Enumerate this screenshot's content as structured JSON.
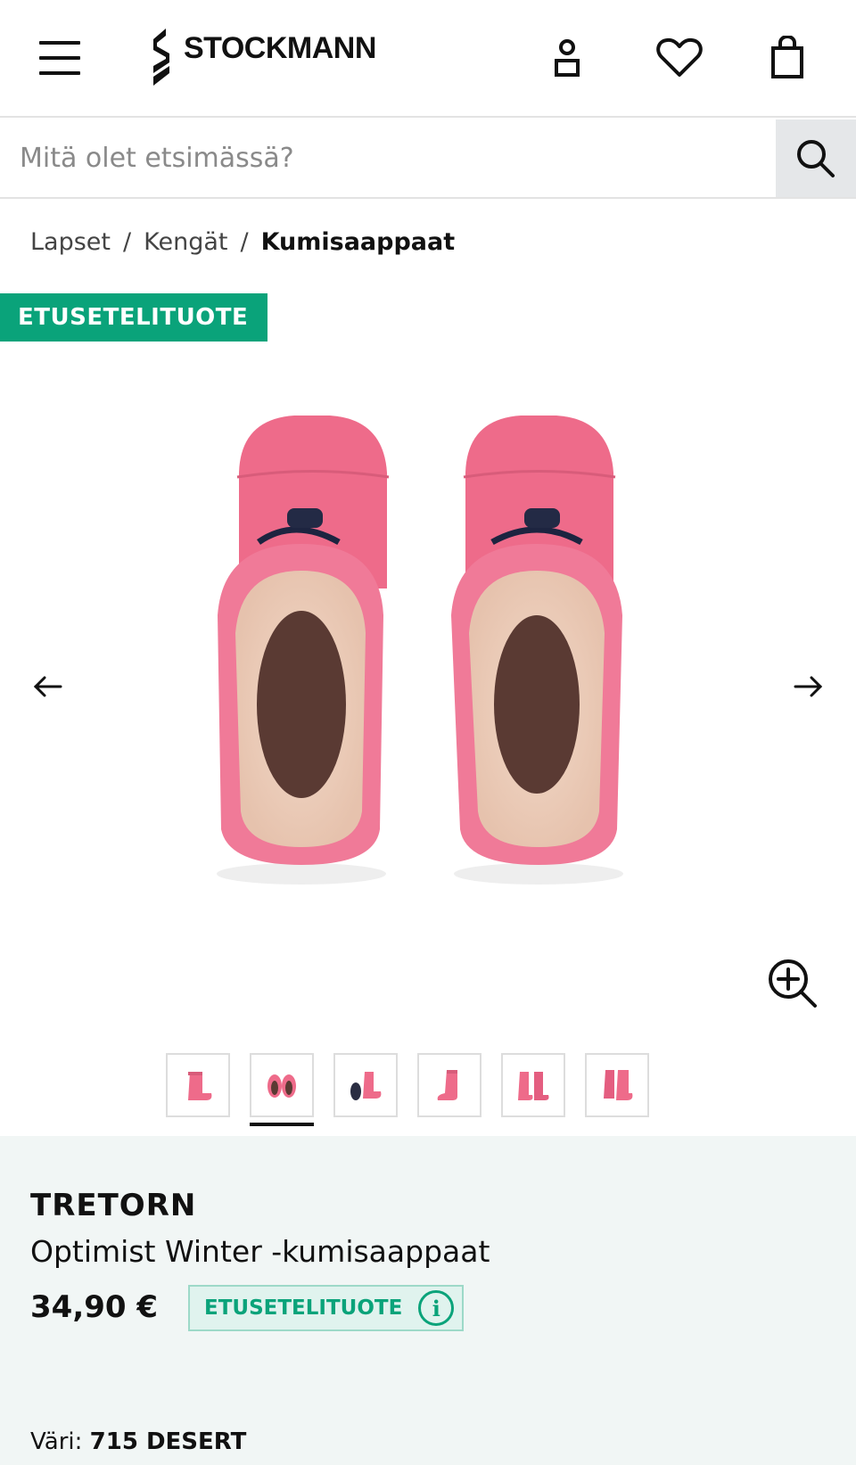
{
  "header": {
    "logo_text": "STOCKMANN",
    "icons": [
      "menu-icon",
      "user-icon",
      "heart-icon",
      "shopping-bag-icon"
    ]
  },
  "search": {
    "placeholder": "Mitä olet etsimässä?",
    "icon": "search-icon"
  },
  "breadcrumb": {
    "items": [
      "Lapset",
      "Kengät"
    ],
    "separator": "/",
    "current": "Kumisaappaat"
  },
  "image_badge": "ETUSETELITUOTE",
  "gallery": {
    "thumbnails_count": 6,
    "active_index": 1
  },
  "product": {
    "brand": "TRETORN",
    "name": "Optimist Winter -kumisaappaat",
    "price": "34,90 €",
    "price_badge": "ETUSETELITUOTE",
    "info_icon_glyph": "i",
    "color_label": "Väri:",
    "color_value": "715 DESERT"
  },
  "colors": {
    "accent": "#0aa37a",
    "panel_bg": "#f1f6f5",
    "boot_pink": "#ee6b8a"
  }
}
